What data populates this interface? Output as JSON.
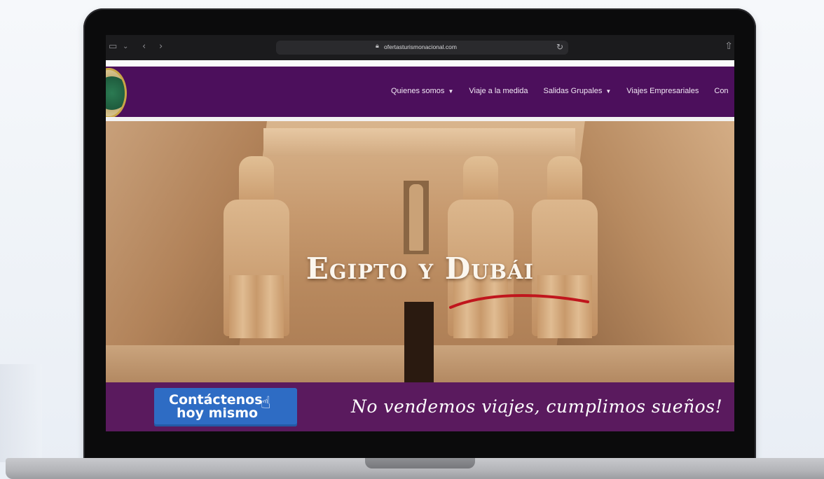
{
  "browser": {
    "url": "ofertasturismonacional.com",
    "icons": [
      "sidebar-icon",
      "chevron-down-icon",
      "back-icon",
      "forward-icon",
      "lock-icon",
      "reload-icon",
      "share-icon"
    ]
  },
  "nav": {
    "items": [
      {
        "label": "Quienes somos",
        "has_dropdown": true
      },
      {
        "label": "Viaje a la medida",
        "has_dropdown": false
      },
      {
        "label": "Salidas Grupales",
        "has_dropdown": true
      },
      {
        "label": "Viajes Empresariales",
        "has_dropdown": false
      },
      {
        "label": "Con",
        "has_dropdown": false
      }
    ]
  },
  "hero": {
    "title": "Egipto y Dubái",
    "underline_color": "#c0161d"
  },
  "footer_band": {
    "contact_line1": "Contáctenos",
    "contact_line2": "hoy mismo",
    "slogan": "No vendemos viajes, cumplimos sueños!"
  },
  "colors": {
    "nav_bg": "#4c0f5c",
    "band_bg": "#5a1a5e",
    "button_bg": "#2e6cc4"
  }
}
